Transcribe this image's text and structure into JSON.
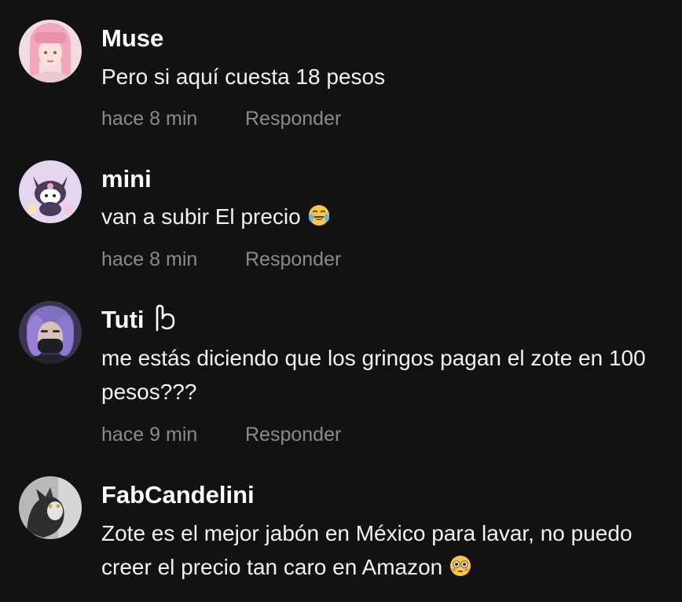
{
  "comments": [
    {
      "username": "Muse",
      "text": "Pero si aquí cuesta 18 pesos",
      "time": "hace 8 min",
      "reply_label": "Responder"
    },
    {
      "username": "mini",
      "text": "van a subir El precio",
      "emoji": "face-with-tears-of-joy",
      "time": "hace 8 min",
      "reply_label": "Responder"
    },
    {
      "username": "Tuti",
      "badge_icon": "hand-outline-icon",
      "text": "me estás diciendo que los gringos pagan el zote en 100 pesos???",
      "time": "hace 9 min",
      "reply_label": "Responder"
    },
    {
      "username": "FabCandelini",
      "text": "Zote es el mejor jabón en México para lavar, no puedo creer el precio tan caro en Amazon",
      "emoji": "flushed-face",
      "time": "",
      "reply_label": ""
    }
  ],
  "colors": {
    "background": "#121212",
    "username": "#ffffff",
    "text": "#f2f2f2",
    "meta": "#8a8a8a"
  }
}
